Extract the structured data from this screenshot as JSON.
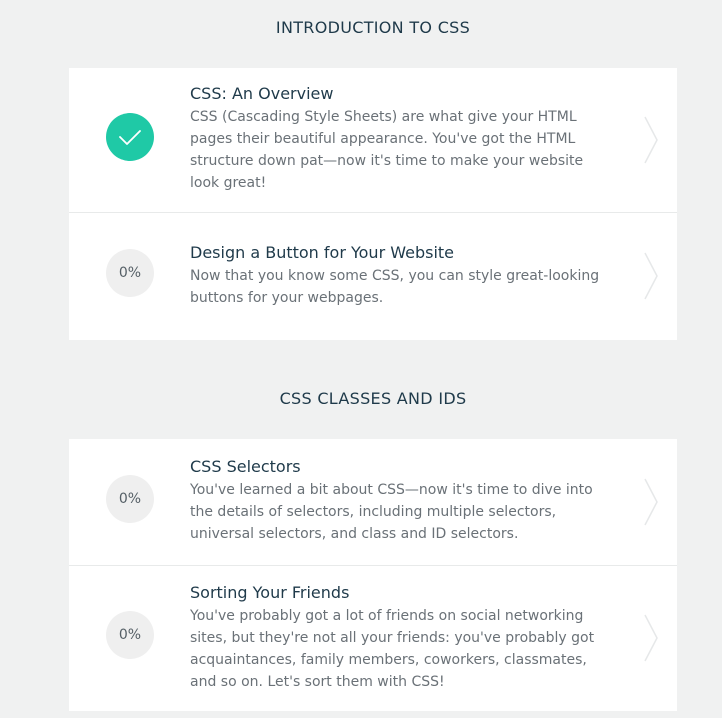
{
  "sections": [
    {
      "title": "INTRODUCTION TO CSS",
      "lessons": [
        {
          "title": "CSS: An Overview",
          "description": "CSS (Cascading Style Sheets) are what give your HTML pages their beautiful appearance. You've got the HTML structure down pat—now it's time to make your website look great!",
          "status": "complete",
          "status_icon": "checkmark-icon"
        },
        {
          "title": "Design a Button for Your Website",
          "description": "Now that you know some CSS, you can style great-looking buttons for your webpages.",
          "status": "progress",
          "progress_label": "0%"
        }
      ]
    },
    {
      "title": "CSS CLASSES AND IDS",
      "lessons": [
        {
          "title": "CSS Selectors",
          "description": "You've learned a bit about CSS—now it's time to dive into the details of selectors, including multiple selectors, universal selectors, and class and ID selectors.",
          "status": "progress",
          "progress_label": "0%"
        },
        {
          "title": "Sorting Your Friends",
          "description": "You've probably got a lot of friends on social networking sites, but they're not all your friends: you've probably got acquaintances, family members, coworkers, classmates, and so on. Let's sort them with CSS!",
          "status": "progress",
          "progress_label": "0%"
        }
      ]
    }
  ],
  "colors": {
    "accent": "#1fc9a6",
    "text": "#1f3a4a",
    "muted": "#6a7177",
    "background": "#f0f1f1"
  },
  "icons": {
    "complete": "checkmark-icon",
    "row_action": "chevron-right-icon"
  }
}
